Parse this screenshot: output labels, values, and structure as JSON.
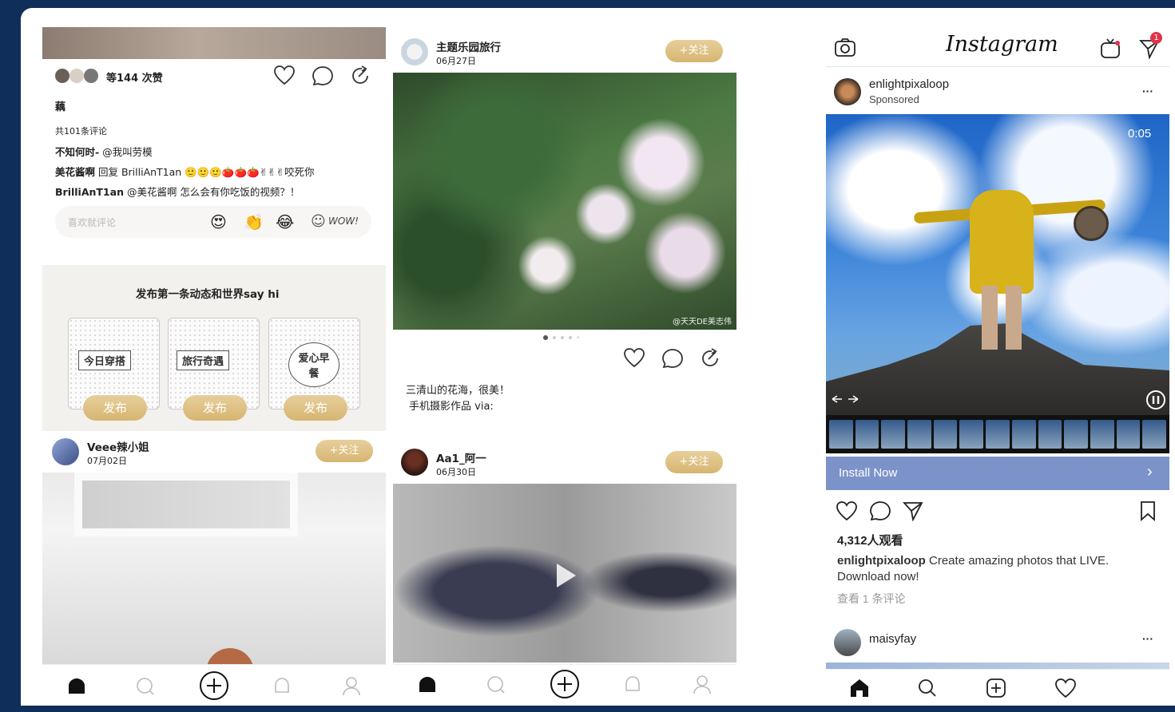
{
  "panel1": {
    "likes": "等144 次赞",
    "caption": "藕",
    "comment_count": "共101条评论",
    "comments": [
      {
        "user": "不知何时-",
        "text": " @我叫劳模"
      },
      {
        "user": "美花酱啊",
        "text": " 回复 BrilliAnT1an 🙂🙂🙂🍅🍅🍅✌✌✌咬死你"
      },
      {
        "user": "BrilliAnT1an",
        "text": " @美花酱啊 怎么会有你吃饭的视频？！"
      }
    ],
    "comment_placeholder": "喜欢就评论",
    "wow_label": "WOW!",
    "prompt": "发布第一条动态和世界say hi",
    "cards": [
      {
        "label": "今日穿搭",
        "button": "发布"
      },
      {
        "label": "旅行奇遇",
        "button": "发布"
      },
      {
        "label": "爱心早餐",
        "button": "发布"
      }
    ],
    "post": {
      "username": "Veee辣小姐",
      "date": "07月02日",
      "follow": "+关注"
    }
  },
  "panel2": {
    "post1": {
      "username": "主题乐园旅行",
      "date": "06月27日",
      "follow": "+关注",
      "watermark": "@天天DE美志伟"
    },
    "caption_line1": "三清山的花海，很美！",
    "caption_line2": "手机摄影作品  via:",
    "post2": {
      "username": "Aa1_阿一",
      "date": "06月30日",
      "follow": "+关注"
    }
  },
  "panel3": {
    "logo": "Instagram",
    "notif_count": "1",
    "account": "enlightpixaloop",
    "sponsored": "Sponsored",
    "menu": "···",
    "video_time": "0:05",
    "install": "Install Now",
    "install_chevron": "›",
    "views": "4,312人观看",
    "caption_user": "enlightpixaloop",
    "caption_text": " Create amazing photos that LIVE.",
    "caption_line2": "Download now!",
    "view_comments": "查看 1 条评论",
    "next_user": "maisyfay",
    "next_menu": "···"
  },
  "colors": {
    "background": "#0f2e5a",
    "gold": "#d6b571",
    "ig_blue": "#7c93c9"
  }
}
